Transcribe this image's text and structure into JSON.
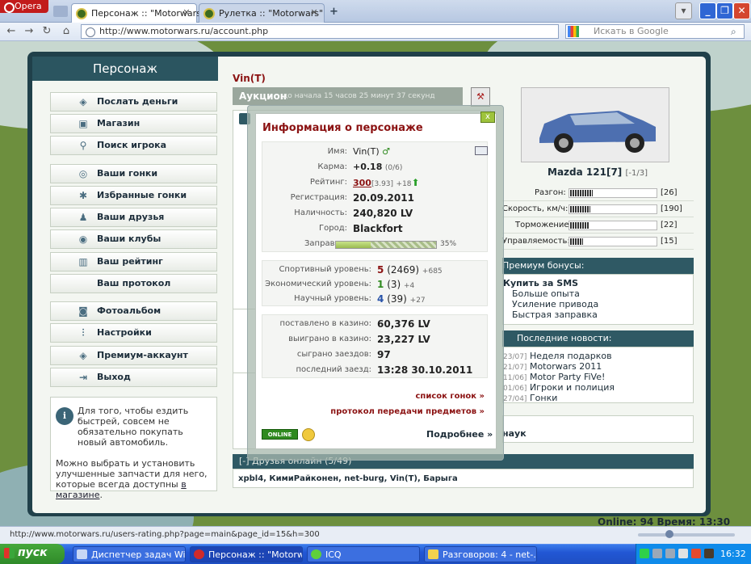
{
  "browser": {
    "menu_label": "Opera",
    "tabs": [
      {
        "label": "Персонаж :: \"Motorwars\"",
        "active": true
      },
      {
        "label": "Рулетка :: \"Motorwars\"",
        "active": false
      }
    ],
    "add_tab": "+",
    "url": "http://www.motorwars.ru/account.php",
    "search_placeholder": "Искать в Google",
    "status_url": "http://www.motorwars.ru/users-rating.php?page=main&page_id=15&h=300"
  },
  "sidebar": {
    "title": "Персонаж",
    "items": [
      {
        "label": "Послать деньги",
        "icon": "money-icon"
      },
      {
        "label": "Магазин",
        "icon": "shop-icon"
      },
      {
        "label": "Поиск игрока",
        "icon": "search-icon"
      },
      {
        "label": "Ваши гонки",
        "icon": "steering-wheel-icon"
      },
      {
        "label": "Избранные гонки",
        "icon": "favorite-races-icon"
      },
      {
        "label": "Ваши друзья",
        "icon": "friends-icon"
      },
      {
        "label": "Ваши клубы",
        "icon": "clubs-icon"
      },
      {
        "label": "Ваш рейтинг",
        "icon": "rating-icon"
      },
      {
        "label": "Ваш протокол",
        "icon": ""
      },
      {
        "label": "Фотоальбом",
        "icon": "photo-icon"
      },
      {
        "label": "Настройки",
        "icon": "settings-icon"
      },
      {
        "label": "Премиум-аккаунт",
        "icon": "premium-icon"
      },
      {
        "label": "Выход",
        "icon": "exit-icon"
      }
    ],
    "info_text": "Для того, чтобы ездить быстрей, совсем не обязательно покупать новый автомобиль.",
    "info_text2": "Можно выбрать и установить улучшенные запчасти для него, которые всегда доступны ",
    "info_link": "в магазине",
    "info_end": "."
  },
  "main": {
    "character_name": "Vin(T)",
    "auction_label": "Аукцион",
    "auction_sub": "до начала 15 часов 25 минут 37 секунд"
  },
  "car": {
    "name": "Mazda 121[7]",
    "rank": "[-1/3]",
    "stats": [
      {
        "label": "Разгон:",
        "value": "[26]",
        "level": 0.26
      },
      {
        "label": "Скорость, км/ч:",
        "value": "[190]",
        "level": 0.24
      },
      {
        "label": "Торможение:",
        "value": "[22]",
        "level": 0.22
      },
      {
        "label": "Управляемость:",
        "value": "[15]",
        "level": 0.15
      }
    ]
  },
  "premium": {
    "title": "Премиум бонусы:",
    "buy": "Купить за SMS",
    "items": [
      "Больше опыта",
      "Усиление привода",
      "Быстрая заправка"
    ]
  },
  "news": {
    "title": "Последние новости:",
    "items": [
      {
        "date": "23/07]",
        "text": "Неделя подарков"
      },
      {
        "date": "21/07]",
        "text": "Motorwars 2011"
      },
      {
        "date": "11/06]",
        "text": "Motor Party FiVe!"
      },
      {
        "date": "01/06]",
        "text": "Игроки и полиция"
      },
      {
        "date": "27/04]",
        "text": "Гонки"
      }
    ]
  },
  "science_label": "наук",
  "friends_online": {
    "title": "[-]  Друзья онлайн (5/49)",
    "list": "xpbl4, КимиРайконен, net-burg, Vin(T), Барыга"
  },
  "status_line": "Online: 94  Время: 13:30",
  "popup": {
    "title": "Информация о персонаже",
    "close": "x",
    "name_label": "Имя:",
    "name": "Vin(T)",
    "karma_label": "Карма:",
    "karma": "+0.18",
    "karma_sub": "(0/6)",
    "rating_label": "Рейтинг:",
    "rating": "300",
    "rating_sub": "[3.93]",
    "rating_delta": "+18",
    "reg_label": "Регистрация:",
    "reg": "20.09.2011",
    "cash_label": "Наличность:",
    "cash": "240,820 LV",
    "city_label": "Город:",
    "city": "Blackfort",
    "fuel_label": "Заправка:",
    "fuel_percent": "35%",
    "fuel_level": 0.35,
    "levels": [
      {
        "label": "Спортивный уровень:",
        "level": "5",
        "points": "(2469)",
        "delta": "+685"
      },
      {
        "label": "Экономический уровень:",
        "level": "1",
        "points": "(3)",
        "delta": "+4"
      },
      {
        "label": "Научный уровень:",
        "level": "4",
        "points": "(39)",
        "delta": "+27"
      }
    ],
    "casino": [
      {
        "label": "поставлено в казино:",
        "value": "60,376 LV"
      },
      {
        "label": "выиграно в казино:",
        "value": "23,227 LV"
      },
      {
        "label": "сыграно заездов:",
        "value": "97"
      },
      {
        "label": "последний заезд:",
        "value": "13:28 30.10.2011"
      }
    ],
    "link_races": "список гонок »",
    "link_transfers": "протокол передачи предметов »",
    "online_badge": "ONLINE",
    "more": "Подробнее »"
  },
  "taskbar": {
    "start": "пуск",
    "tasks": [
      {
        "label": "Диспетчер задач Wi..."
      },
      {
        "label": "Персонаж :: \"Motorw..."
      },
      {
        "label": "ICQ"
      },
      {
        "label": "Разговоров: 4 - net-..."
      }
    ],
    "clock": "16:32"
  },
  "colors": {
    "accent_red": "#8b1212",
    "header_teal": "#2f5964",
    "frame": "#20404a",
    "taskbar_blue": "#2257d4"
  }
}
